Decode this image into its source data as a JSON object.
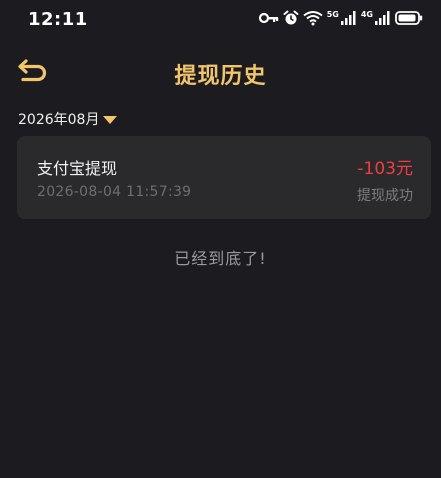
{
  "status_bar": {
    "time": "12:11",
    "net_5g": "5G",
    "net_4g": "4G"
  },
  "header": {
    "title": "提现历史",
    "accent_color": "#f2c46b"
  },
  "filter": {
    "month": "2026年08月"
  },
  "records": [
    {
      "title": "支付宝提现",
      "time": "2026-08-04 11:57:39",
      "amount": "-103元",
      "status": "提现成功",
      "amount_color": "#ee3e3f"
    }
  ],
  "footer": {
    "end_text": "已经到底了!"
  }
}
